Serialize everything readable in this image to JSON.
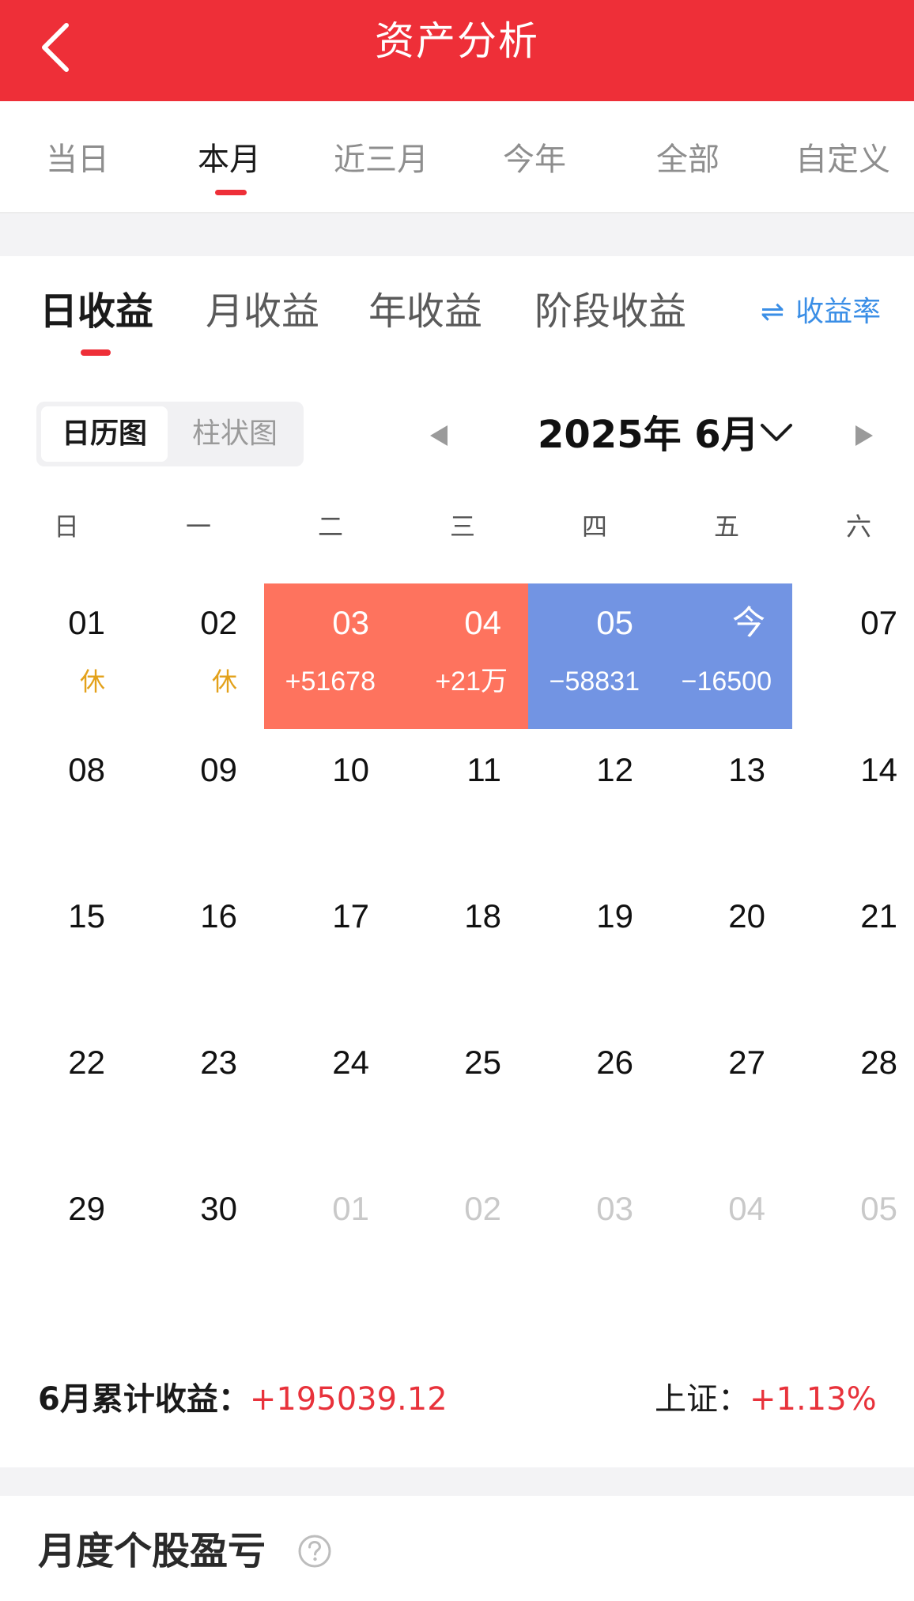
{
  "header": {
    "title": "资产分析"
  },
  "period_tabs": [
    "当日",
    "本月",
    "近三月",
    "今年",
    "全部",
    "自定义"
  ],
  "period_active": 1,
  "income_tabs": [
    "日收益",
    "月收益",
    "年收益",
    "阶段收益"
  ],
  "income_active": 0,
  "rate_link": {
    "icon": "swap-icon",
    "label": "收益率"
  },
  "view_toggle": [
    "日历图",
    "柱状图"
  ],
  "view_active": 0,
  "month_label": "2025年 6月",
  "weekdays": [
    "日",
    "一",
    "二",
    "三",
    "四",
    "五",
    "六"
  ],
  "calendar": [
    [
      {
        "d": "01",
        "sub": "休",
        "kind": "rest"
      },
      {
        "d": "02",
        "sub": "休",
        "kind": "rest"
      },
      {
        "d": "03",
        "sub": "+51678",
        "kind": "gain"
      },
      {
        "d": "04",
        "sub": "+21万",
        "kind": "gain"
      },
      {
        "d": "05",
        "sub": "−58831",
        "kind": "loss"
      },
      {
        "d": "今",
        "sub": "−16500",
        "kind": "loss"
      },
      {
        "d": "07",
        "sub": "",
        "kind": ""
      }
    ],
    [
      {
        "d": "08"
      },
      {
        "d": "09"
      },
      {
        "d": "10"
      },
      {
        "d": "11"
      },
      {
        "d": "12"
      },
      {
        "d": "13"
      },
      {
        "d": "14"
      }
    ],
    [
      {
        "d": "15"
      },
      {
        "d": "16"
      },
      {
        "d": "17"
      },
      {
        "d": "18"
      },
      {
        "d": "19"
      },
      {
        "d": "20"
      },
      {
        "d": "21"
      }
    ],
    [
      {
        "d": "22"
      },
      {
        "d": "23"
      },
      {
        "d": "24"
      },
      {
        "d": "25"
      },
      {
        "d": "26"
      },
      {
        "d": "27"
      },
      {
        "d": "28"
      }
    ],
    [
      {
        "d": "29"
      },
      {
        "d": "30"
      },
      {
        "d": "01",
        "kind": "other"
      },
      {
        "d": "02",
        "kind": "other"
      },
      {
        "d": "03",
        "kind": "other"
      },
      {
        "d": "04",
        "kind": "other"
      },
      {
        "d": "05",
        "kind": "other"
      }
    ]
  ],
  "summary": {
    "label": "6月累计收益：",
    "value": "+195039.12",
    "index_label": "上证：",
    "index_value": "+1.13%"
  },
  "section": {
    "title": "月度个股盈亏",
    "help_icon": "help-circle-icon"
  },
  "colors": {
    "header": "#ee2f38",
    "gain": "#fe735e",
    "loss": "#7294e3",
    "rest": "#e3a11a",
    "link": "#3a8ee6"
  }
}
